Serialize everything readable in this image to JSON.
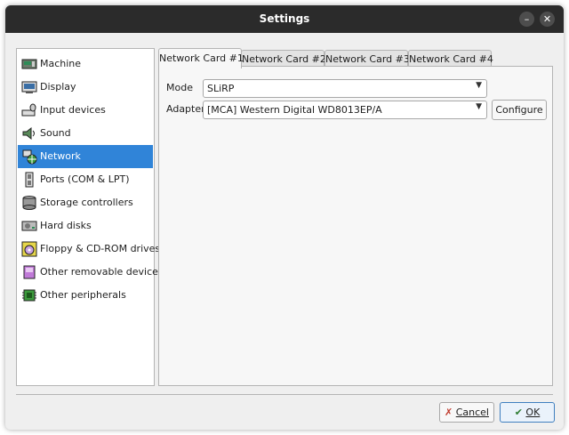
{
  "window": {
    "title": "Settings"
  },
  "sidebar": {
    "items": [
      {
        "label": "Machine",
        "icon": "machine-icon"
      },
      {
        "label": "Display",
        "icon": "display-icon"
      },
      {
        "label": "Input devices",
        "icon": "input-devices-icon"
      },
      {
        "label": "Sound",
        "icon": "sound-icon"
      },
      {
        "label": "Network",
        "icon": "network-icon",
        "selected": true
      },
      {
        "label": "Ports (COM & LPT)",
        "icon": "ports-icon"
      },
      {
        "label": "Storage controllers",
        "icon": "storage-controllers-icon"
      },
      {
        "label": "Hard disks",
        "icon": "hard-disk-icon"
      },
      {
        "label": "Floppy & CD-ROM drives",
        "icon": "floppy-cdrom-icon"
      },
      {
        "label": "Other removable devices",
        "icon": "removable-devices-icon"
      },
      {
        "label": "Other peripherals",
        "icon": "peripherals-icon"
      }
    ]
  },
  "tabs": [
    {
      "label": "Network Card #1",
      "active": true
    },
    {
      "label": "Network Card #2"
    },
    {
      "label": "Network Card #3"
    },
    {
      "label": "Network Card #4"
    }
  ],
  "form": {
    "mode_label": "Mode",
    "mode_value": "SLiRP",
    "adapter_label": "Adapter",
    "adapter_value": "[MCA] Western Digital WD8013EP/A",
    "configure_label": "Configure"
  },
  "footer": {
    "cancel_label": "Cancel",
    "ok_label": "OK"
  },
  "colors": {
    "selection": "#3084d8",
    "titlebar": "#2b2b2b"
  }
}
